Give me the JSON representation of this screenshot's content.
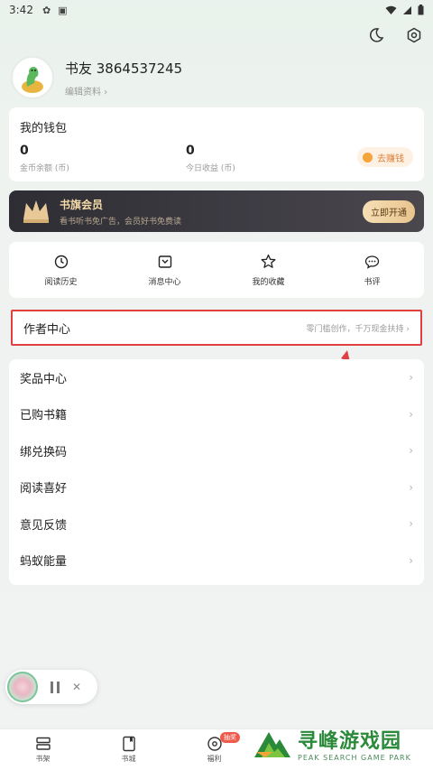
{
  "status_bar": {
    "time": "3:42",
    "app_icons": [
      "wechat-icon",
      "a-icon"
    ]
  },
  "profile": {
    "username": "书友 3864537245",
    "edit_label": "编辑资料 ›"
  },
  "wallet": {
    "title": "我的钱包",
    "coin_balance": "0",
    "coin_label": "金币余额 (币)",
    "today_income": "0",
    "today_label": "今日收益 (币)",
    "earn_button": "去赚钱"
  },
  "vip": {
    "title": "书旗会员",
    "subtitle": "看书听书免广告，会员好书免费读",
    "button": "立即开通"
  },
  "quick_actions": [
    {
      "label": "阅读历史",
      "icon": "clock-icon"
    },
    {
      "label": "消息中心",
      "icon": "inbox-icon"
    },
    {
      "label": "我的收藏",
      "icon": "star-icon"
    },
    {
      "label": "书评",
      "icon": "chat-icon"
    }
  ],
  "author_center": {
    "label": "作者中心",
    "subtitle": "零门槛创作，千万现金扶持 ›"
  },
  "menu": [
    {
      "label": "奖品中心"
    },
    {
      "label": "已购书籍"
    },
    {
      "label": "绑兑换码"
    },
    {
      "label": "阅读喜好"
    },
    {
      "label": "意见反馈"
    },
    {
      "label": "蚂蚁能量"
    }
  ],
  "tabs": [
    {
      "label": "书架",
      "icon": "bookshelf-icon"
    },
    {
      "label": "书城",
      "icon": "bookstore-icon"
    },
    {
      "label": "福利",
      "icon": "gift-icon",
      "badge": "抽奖"
    }
  ],
  "watermark": {
    "cn": "寻峰游戏园",
    "en": "PEAK SEARCH GAME PARK"
  },
  "colors": {
    "highlight": "#e04040",
    "accent_orange": "#e0803a",
    "vip_gold": "#f2d9a8",
    "watermark_green": "#2a8a3a"
  }
}
